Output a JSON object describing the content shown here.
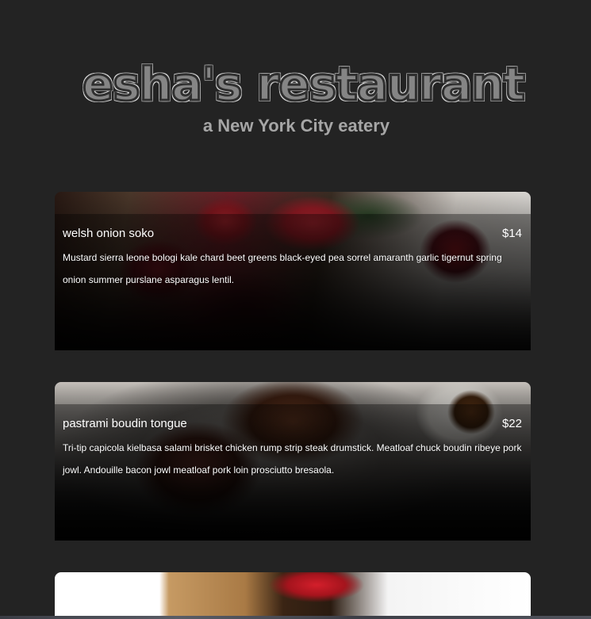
{
  "header": {
    "title": "esha's restaurant",
    "subtitle": "a New York City eatery"
  },
  "menu": {
    "items": [
      {
        "name": "welsh onion soko",
        "price": "$14",
        "description": "Mustard sierra leone bologi kale chard beet greens black-eyed pea sorrel amaranth garlic tigernut spring onion summer purslane asparagus lentil."
      },
      {
        "name": "pastrami boudin tongue",
        "price": "$22",
        "description": "Tri-tip capicola kielbasa salami brisket chicken rump strip steak drumstick. Meatloaf chuck boudin ribeye pork jowl. Andouille bacon jowl meatloaf pork loin prosciutto bresaola."
      }
    ]
  },
  "colors": {
    "background": "#232323",
    "title": "#858585",
    "subtitle": "#a6a6a6",
    "card_text": "#ffffff"
  }
}
